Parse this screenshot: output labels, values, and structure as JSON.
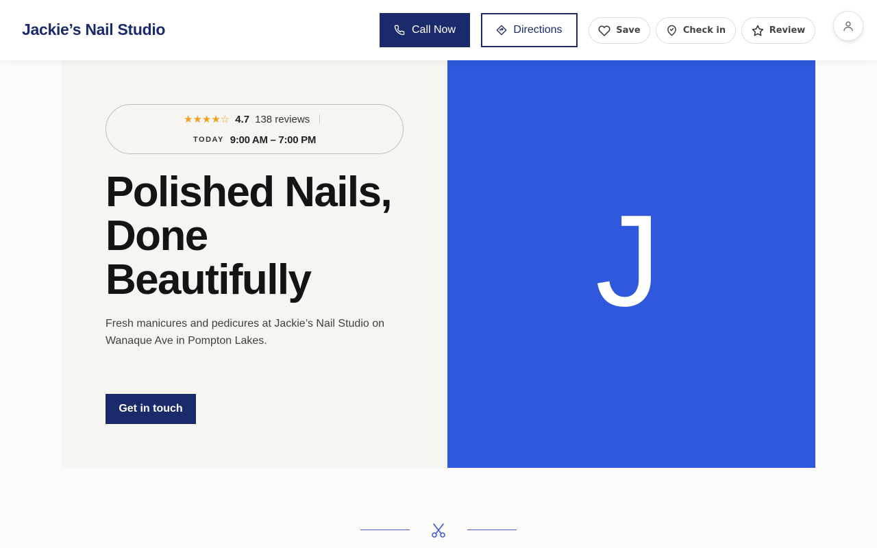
{
  "header": {
    "brand": "Jackie’s Nail Studio",
    "call_label": "Call Now",
    "directions_label": "Directions",
    "save_label": "Save",
    "checkin_label": "Check in",
    "review_label": "Review"
  },
  "hero": {
    "rating": "4.7",
    "rating_value": 4.7,
    "stars_max": 5,
    "stars_text": "★★★★☆",
    "review_count": "138 reviews",
    "today_label": "TODAY",
    "hours": "9:00 AM – 7:00 PM",
    "headline_line1": "Polished Nails,",
    "headline_line2": "Done",
    "headline_line3": "Beautifully",
    "subtext": "Fresh manicures and pedicures at Jackie’s Nail Studio on Wanaque Ave in Pompton Lakes.",
    "cta_label": "Get in touch",
    "monogram": "J"
  },
  "icons": {
    "call": "phone-icon",
    "directions": "directions-icon",
    "save": "heart-icon",
    "checkin": "map-pin-icon",
    "review": "star-icon",
    "account": "user-icon",
    "divider": "scissors-icon"
  },
  "colors": {
    "brand_navy": "#1b2a6b",
    "hero_blue": "#2f58dc",
    "star_orange": "#f0a020",
    "hero_left_bg": "#f6f5f2"
  }
}
